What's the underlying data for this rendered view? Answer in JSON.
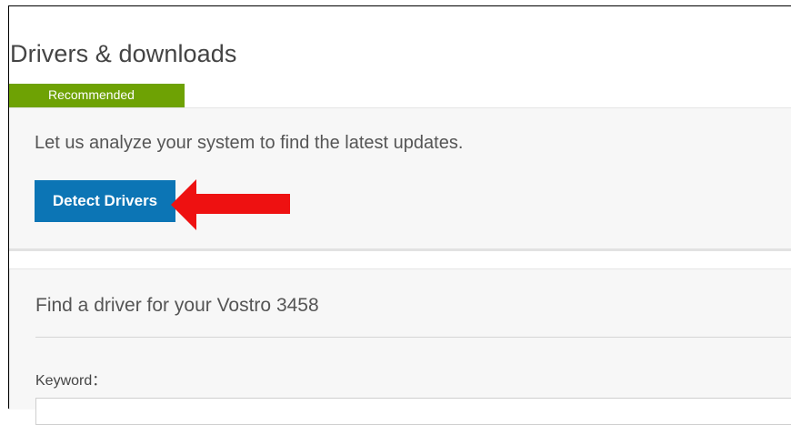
{
  "page": {
    "title": "Drivers & downloads"
  },
  "recommended": {
    "tag": "Recommended",
    "description": "Let us analyze your system to find the latest updates.",
    "detect_button_label": "Detect Drivers",
    "annotation_icon": "red-arrow-left-icon"
  },
  "find_driver": {
    "heading": "Find a driver for your Vostro 3458",
    "keyword_label": "Keyword：",
    "keyword_value": "",
    "keyword_placeholder": ""
  },
  "colors": {
    "recommended_tag": "#6ea204",
    "detect_button": "#0c75b5",
    "annotation_arrow": "#ee1111",
    "panel_background": "#f7f7f7"
  }
}
